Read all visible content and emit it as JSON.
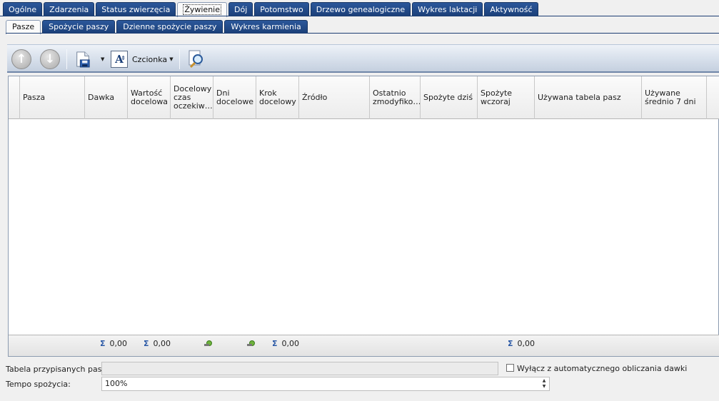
{
  "top_tabs": [
    {
      "label": "Ogólne"
    },
    {
      "label": "Zdarzenia"
    },
    {
      "label": "Status zwierzęcia"
    },
    {
      "label": "Żywienie",
      "active": true
    },
    {
      "label": "Dój"
    },
    {
      "label": "Potomstwo"
    },
    {
      "label": "Drzewo genealogiczne"
    },
    {
      "label": "Wykres laktacji"
    },
    {
      "label": "Aktywność"
    }
  ],
  "sub_tabs": [
    {
      "label": "Pasze",
      "active": true
    },
    {
      "label": "Spożycie paszy"
    },
    {
      "label": "Dzienne spożycie paszy"
    },
    {
      "label": "Wykres karmienia"
    }
  ],
  "toolbar": {
    "up_icon": "arrow-up-icon",
    "down_icon": "arrow-down-icon",
    "save_icon": "save-icon",
    "font_icon": "font-icon",
    "font_label": "Czcionka",
    "preview_icon": "magnifier-icon"
  },
  "grid": {
    "columns": [
      "Pasza",
      "Dawka",
      "Wartość docelowa",
      "Docelowy czas oczekiw…",
      "Dni docelowe",
      "Krok docelowy",
      "Źródło",
      "Ostatnio zmodyfiko…",
      "Spożyte dziś",
      "Spożyte wczoraj",
      "Używana tabela pasz",
      "Używane średnio 7 dni"
    ],
    "rows": [],
    "summary": {
      "dawka": "0,00",
      "wartosc_docelowa": "0,00",
      "krok_docelowy": "0,00",
      "spozyte_wczoraj": "0,00"
    }
  },
  "form": {
    "assigned_feeds_label": "Tabela przypisanych pasz:",
    "assigned_feeds_value": "",
    "exclude_auto_label": "Wyłącz z automatycznego obliczania dawki",
    "exclude_auto_checked": false,
    "tempo_label": "Tempo spożycia:",
    "tempo_value": "100%"
  }
}
